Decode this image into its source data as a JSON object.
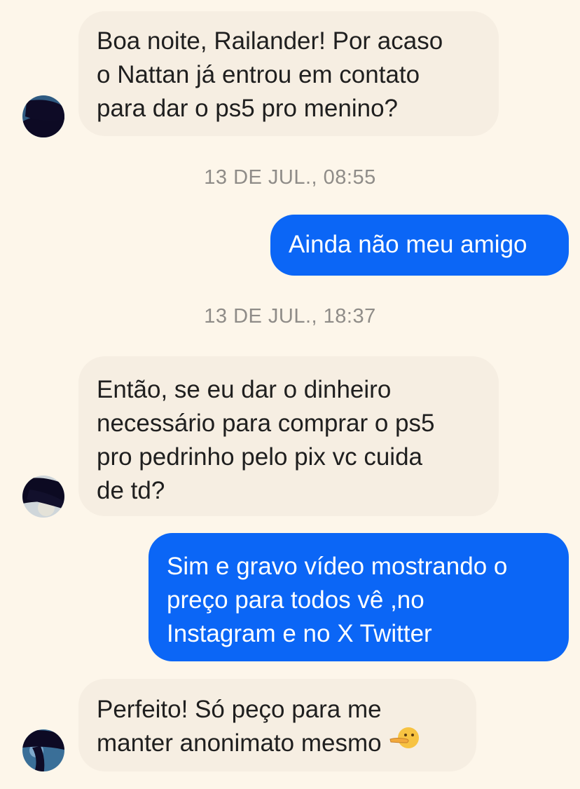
{
  "conversation": {
    "messages": [
      {
        "direction": "incoming",
        "lines": [
          "Boa noite, Railander! Por acaso",
          "o Nattan já entrou em contato",
          "para dar o ps5 pro menino?"
        ]
      },
      {
        "direction": "outgoing",
        "lines": [
          "Ainda não meu amigo"
        ]
      },
      {
        "direction": "incoming",
        "lines": [
          "Então, se eu dar o dinheiro",
          "necessário para comprar o ps5",
          "pro pedrinho pelo pix vc cuida",
          "de td?"
        ]
      },
      {
        "direction": "outgoing",
        "lines": [
          "Sim e gravo vídeo mostrando o",
          "preço para todos vê ,no",
          "Instagram e no X Twitter"
        ]
      },
      {
        "direction": "incoming",
        "lines": [
          "Perfeito! Só peço para me",
          "manter anonimato mesmo"
        ],
        "emoji": "finger-over-mouth-emoji"
      }
    ],
    "timestamps": [
      "13 DE JUL., 08:55",
      "13 DE JUL., 18:37"
    ]
  },
  "colors": {
    "background": "#fdf6ea",
    "incoming_bubble": "#f6eee2",
    "outgoing_bubble": "#0b66f6",
    "timestamp_text": "#8f8c88"
  }
}
